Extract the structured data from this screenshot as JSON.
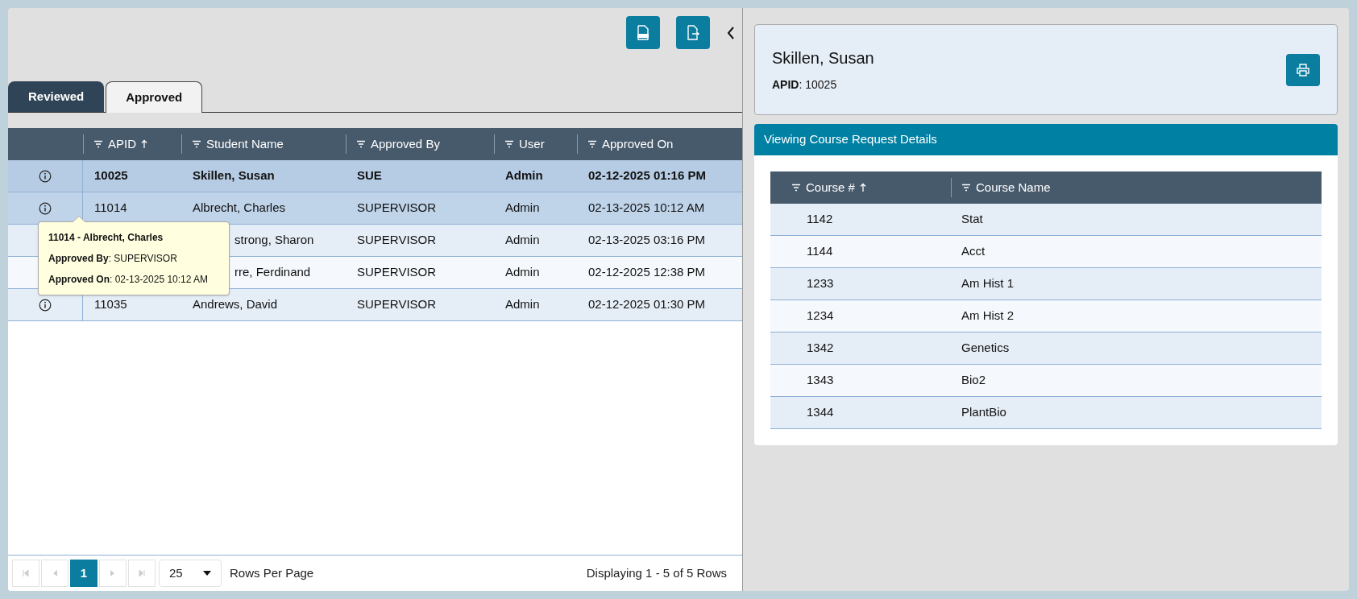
{
  "tabs": [
    {
      "label": "Reviewed",
      "selected": false
    },
    {
      "label": "Approved",
      "selected": true
    }
  ],
  "table": {
    "columns": [
      {
        "label": "APID",
        "sorted": true
      },
      {
        "label": "Student Name",
        "sorted": false
      },
      {
        "label": "Approved By",
        "sorted": false
      },
      {
        "label": "User",
        "sorted": false
      },
      {
        "label": "Approved On",
        "sorted": false
      }
    ],
    "rows": [
      {
        "apid": "10025",
        "name": "Skillen, Susan",
        "approved_by": "SUE",
        "user": "Admin",
        "approved_on": "02-12-2025 01:16 PM",
        "selected": true,
        "hovered": false,
        "covered": false
      },
      {
        "apid": "11014",
        "name": "Albrecht, Charles",
        "approved_by": "SUPERVISOR",
        "user": "Admin",
        "approved_on": "02-13-2025 10:12 AM",
        "selected": false,
        "hovered": true,
        "covered": false
      },
      {
        "name": "strong, Sharon",
        "approved_by": "SUPERVISOR",
        "user": "Admin",
        "approved_on": "02-13-2025 03:16 PM",
        "selected": false,
        "hovered": false,
        "covered": true
      },
      {
        "name": "rre, Ferdinand",
        "approved_by": "SUPERVISOR",
        "user": "Admin",
        "approved_on": "02-12-2025 12:38 PM",
        "selected": false,
        "hovered": false,
        "covered": true
      },
      {
        "apid": "11035",
        "name": "Andrews, David",
        "approved_by": "SUPERVISOR",
        "user": "Admin",
        "approved_on": "02-12-2025 01:30 PM",
        "selected": false,
        "hovered": false,
        "covered": false
      }
    ]
  },
  "tooltip": {
    "title": "11014 - Albrecht, Charles",
    "lines": [
      "**Approved By**: SUPERVISOR",
      "**Approved On**: 02-13-2025 10:12 AM"
    ]
  },
  "pagination": {
    "pages": [
      {
        "label": "1",
        "selected": true
      }
    ],
    "rows_per_page": "25",
    "rows_per_page_label": "Rows Per Page",
    "summary": "Displaying 1 - 5 of 5 Rows"
  },
  "detail": {
    "name": "Skillen, Susan",
    "apid": "**APID**: 10025"
  },
  "courses": {
    "title": "Viewing Course Request Details",
    "columns": [
      {
        "label": "Course #",
        "sorted": true
      },
      {
        "label": "Course Name",
        "sorted": false
      }
    ],
    "rows": [
      {
        "number": "1142",
        "name": "Stat"
      },
      {
        "number": "1144",
        "name": "Acct"
      },
      {
        "number": "1233",
        "name": "Am Hist 1"
      },
      {
        "number": "1234",
        "name": "Am Hist 2"
      },
      {
        "number": "1342",
        "name": "Genetics"
      },
      {
        "number": "1343",
        "name": "Bio2"
      },
      {
        "number": "1344",
        "name": "PlantBio"
      }
    ]
  }
}
